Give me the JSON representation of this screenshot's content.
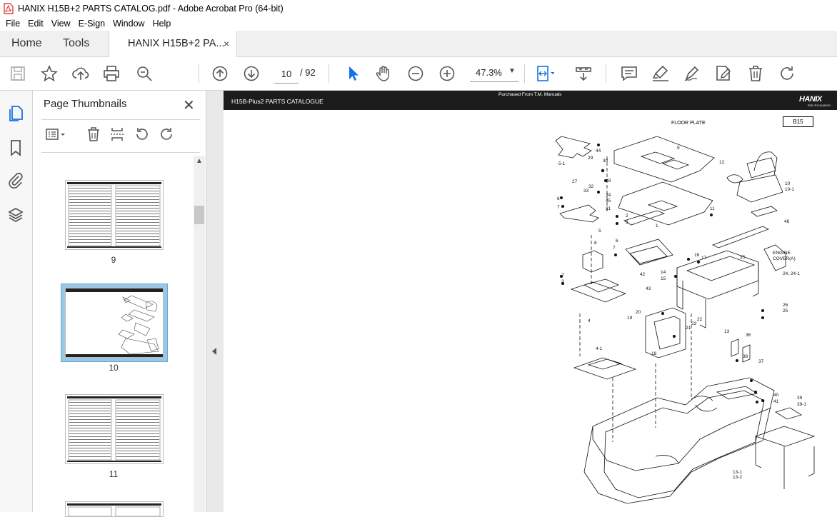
{
  "window": {
    "title": "HANIX H15B+2 PARTS CATALOG.pdf - Adobe Acrobat Pro (64-bit)"
  },
  "menu": [
    "File",
    "Edit",
    "View",
    "E-Sign",
    "Window",
    "Help"
  ],
  "tabs": {
    "home": "Home",
    "tools": "Tools",
    "document": "HANIX H15B+2 PA...",
    "close": "×"
  },
  "toolbar": {
    "current_page": "10",
    "total_pages": "/ 92",
    "zoom": "47.3%",
    "icons": [
      "save-icon",
      "star-icon",
      "upload-icon",
      "print-icon",
      "zoom-search-icon",
      "prev-page-icon",
      "next-page-icon",
      "select-cursor-icon",
      "hand-icon",
      "zoom-out-icon",
      "zoom-in-icon",
      "page-view-icon",
      "scroll-mode-icon",
      "comment-icon",
      "highlight-icon",
      "sign-icon",
      "edit-pdf-icon",
      "delete-icon",
      "rotate-icon"
    ]
  },
  "left_rail": {
    "icons": [
      "pages-icon",
      "bookmark-icon",
      "attachment-icon",
      "layers-icon"
    ]
  },
  "panel": {
    "title": "Page Thumbnails",
    "close": "✕",
    "thumbnails": [
      {
        "label": "9",
        "selected": false
      },
      {
        "label": "10",
        "selected": true
      },
      {
        "label": "11",
        "selected": false
      }
    ]
  },
  "document_page": {
    "header_left": "H15B-Plus2 PARTS CATALOGUE",
    "header_mid": "Purchased From T.M. Manuals",
    "logo": "HANIX",
    "logo_sub": "Mini Excavators",
    "section_title": "FLOOR PLATE",
    "page_code": "B15",
    "callouts": [
      "5-1",
      "44",
      "29",
      "30",
      "9",
      "12",
      "27",
      "32",
      "28",
      "33",
      "10",
      "10-1",
      "6",
      "34",
      "7",
      "45",
      "31",
      "2",
      "11",
      "3",
      "46",
      "5",
      "1",
      "8",
      "6",
      "16",
      "17",
      "7",
      "35",
      "ENGINE",
      "COVER(A)",
      "2",
      "42",
      "14",
      "24, 24-1",
      "3",
      "15",
      "43",
      "26",
      "25",
      "20",
      "19",
      "21",
      "22",
      "4",
      "23",
      "13",
      "18",
      "36",
      "4-1",
      "38",
      "37",
      "40",
      "39",
      "41",
      "39-1",
      "13-1",
      "13-2"
    ]
  }
}
